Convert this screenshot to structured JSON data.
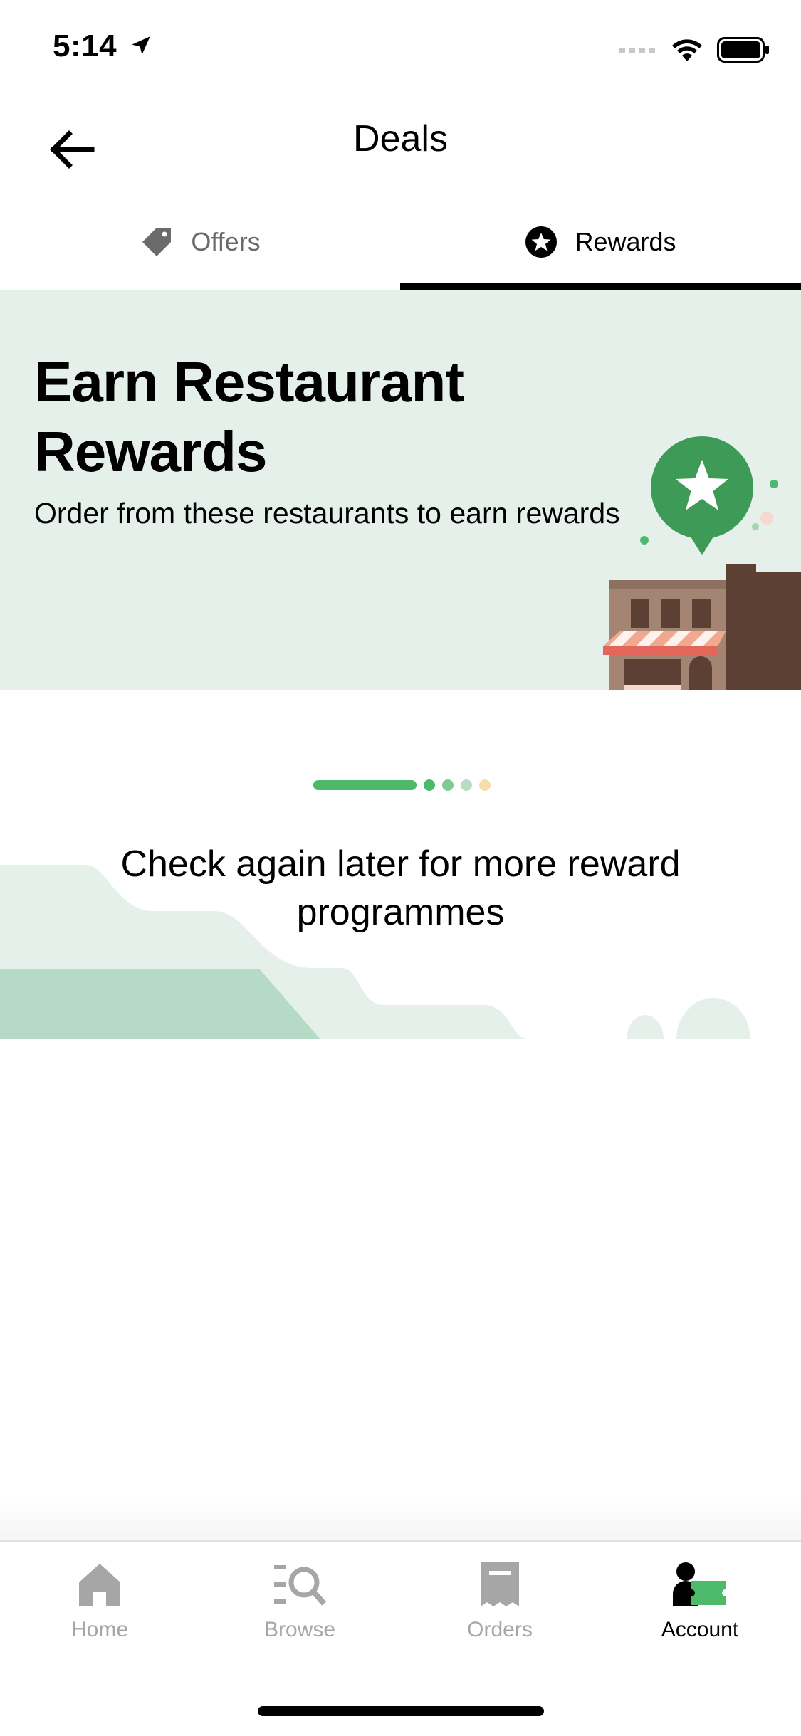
{
  "status_bar": {
    "time": "5:14"
  },
  "header": {
    "title": "Deals"
  },
  "tabs": [
    {
      "label": "Offers",
      "icon": "tag-icon",
      "active": false
    },
    {
      "label": "Rewards",
      "icon": "star-badge-icon",
      "active": true
    }
  ],
  "hero": {
    "title_line1": "Earn Restaurant",
    "title_line2": "Rewards",
    "subtitle": "Order from these restaurants to earn rewards"
  },
  "empty_state": {
    "line1": "Check again later for more reward",
    "line2": "programmes"
  },
  "bottom_nav": [
    {
      "label": "Home",
      "icon": "home-icon",
      "active": false
    },
    {
      "label": "Browse",
      "icon": "browse-icon",
      "active": false
    },
    {
      "label": "Orders",
      "icon": "receipt-icon",
      "active": false
    },
    {
      "label": "Account",
      "icon": "account-icon",
      "active": true
    }
  ],
  "colors": {
    "accent_green": "#4cba6a",
    "hero_bg": "#e6f0eb",
    "inactive_gray": "#a6a6a6"
  }
}
